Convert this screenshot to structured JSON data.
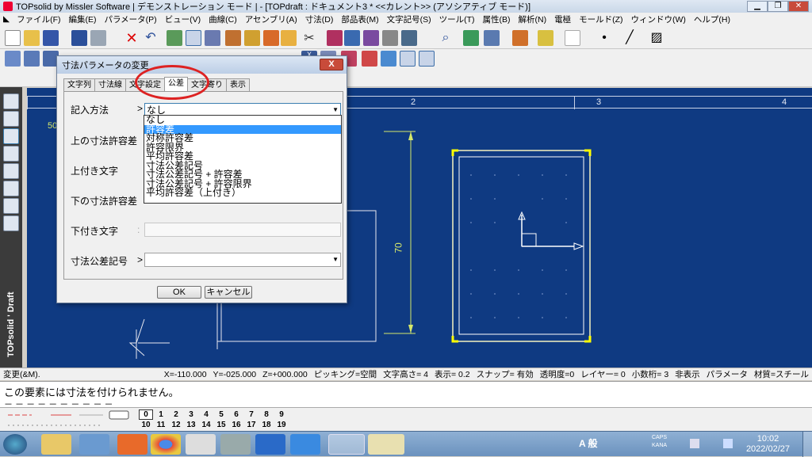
{
  "window": {
    "title": "TOPsolid by Missler Software | デモンストレーション モード | - [TOPdraft : ドキュメント3 *  <<カレント>> (アソシアティブ モード)]"
  },
  "menu": [
    "ファイル(F)",
    "編集(E)",
    "パラメータ(P)",
    "ビュー(V)",
    "曲線(C)",
    "アセンブリ(A)",
    "寸法(D)",
    "部品表(M)",
    "文字記号(S)",
    "ツール(T)",
    "属性(B)",
    "解析(N)",
    "電極",
    "モールド(Z)",
    "ウィンドウ(W)",
    "ヘルプ(H)"
  ],
  "sidebar": {
    "logo": "TOPsolid ' Draft"
  },
  "ruler": {
    "labels": [
      "1",
      "2",
      "3",
      "4"
    ]
  },
  "drawing": {
    "dimension": "70",
    "partial_label": "50"
  },
  "status": [
    "変更(&M).",
    "X=-110.000",
    "Y=-025.000",
    "Z=+000.000",
    "ピッキング=空間",
    "文字高さ=  4",
    "表示=  0.2",
    "スナップ= 有効",
    "透明度=0",
    "レイヤー=  0",
    "小数桁= 3",
    "非表示",
    "パラメータ",
    "材質=スチール"
  ],
  "message": {
    "text": "この要素には寸法を付けられません。",
    "dashes": "－ － － － － － － － － －"
  },
  "layers": {
    "row1": [
      "0",
      "1",
      "2",
      "3",
      "4",
      "5",
      "6",
      "7",
      "8",
      "9"
    ],
    "row2": [
      "10",
      "11",
      "12",
      "13",
      "14",
      "15",
      "16",
      "17",
      "18",
      "19"
    ]
  },
  "clock": {
    "time": "10:02",
    "date": "2022/02/27"
  },
  "tray": {
    "ime": "A 般",
    "caps": "CAPS",
    "kana": "KANA"
  },
  "dialog": {
    "title": "寸法パラメータの変更",
    "close": "X",
    "tabs": [
      "文字列",
      "寸法線",
      "文字設定",
      "公差",
      "文字寄り",
      "表示"
    ],
    "active_tab": "公差",
    "fields": {
      "notation_label": "記入方法",
      "notation_value": "なし",
      "upper_label": "上の寸法許容差",
      "upper_sub_label": "上付き文字",
      "lower_label": "下の寸法許容差",
      "lower_sub_label": "下付き文字",
      "symbol_label": "寸法公差記号"
    },
    "options": [
      "なし",
      "許容差",
      "対称許容差",
      "許容限界",
      "平均許容差",
      "寸法公差記号",
      "寸法公差記号 + 許容差",
      "寸法公差記号 + 許容限界",
      "平均許容差（上付き）"
    ],
    "highlighted_option": "許容差",
    "ok": "OK",
    "cancel": "キャンセル"
  }
}
